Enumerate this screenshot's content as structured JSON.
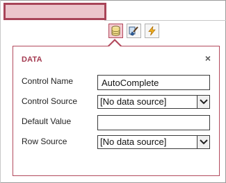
{
  "toolbar": {
    "data_tool": {
      "icon": "database-icon",
      "active": true
    },
    "format_tool": {
      "icon": "paint-brush-icon"
    },
    "action_tool": {
      "icon": "lightning-icon"
    }
  },
  "panel": {
    "title": "DATA",
    "close_icon": "close-icon",
    "close_glyph": "×",
    "fields": {
      "control_name": {
        "label": "Control Name",
        "value": "AutoComplete"
      },
      "control_source": {
        "label": "Control Source",
        "value": "[No data source]"
      },
      "default_value": {
        "label": "Default Value",
        "value": ""
      },
      "row_source": {
        "label": "Row Source",
        "value": "[No data source]"
      }
    }
  },
  "colors": {
    "accent": "#b2495c",
    "title": "#a33a50",
    "selected_control_fill": "#ecc5cc",
    "selected_control_border": "#a84458"
  }
}
